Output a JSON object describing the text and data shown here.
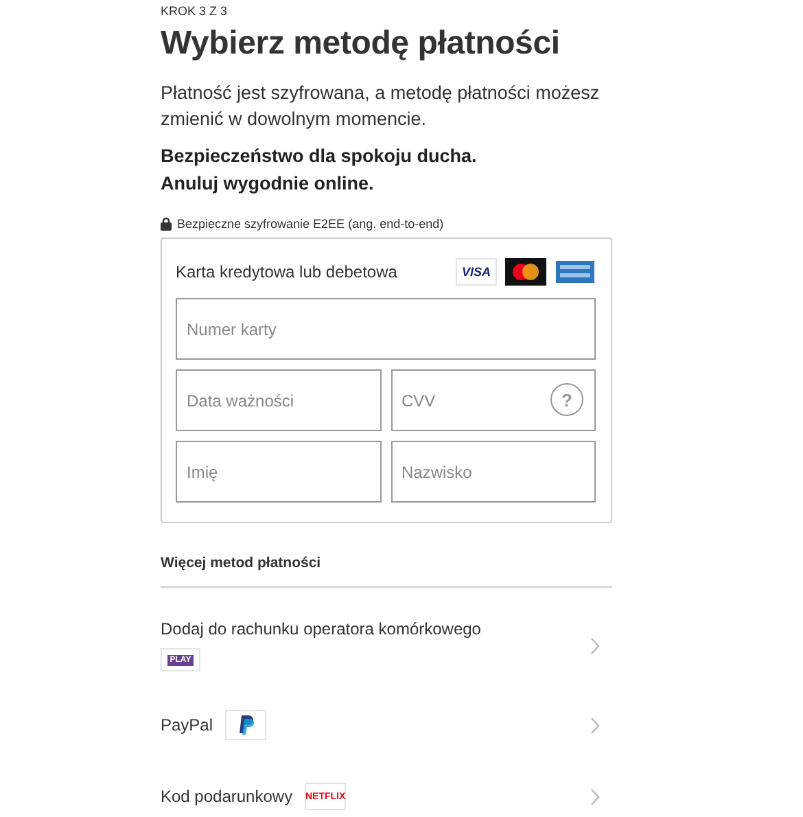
{
  "step": "KROK 3 Z 3",
  "title": "Wybierz metodę płatności",
  "intro": "Płatność jest szyfrowana, a metodę płatności możesz zmienić w dowolnym momencie.",
  "highlights": [
    "Bezpieczeństwo dla spokoju ducha.",
    "Anuluj wygodnie online."
  ],
  "security_note": "Bezpieczne szyfrowanie E2EE (ang. end-to-end)",
  "card": {
    "label": "Karta kredytowa lub debetowa",
    "logos": [
      {
        "kind": "visa",
        "text": "VISA"
      },
      {
        "kind": "mastercard"
      },
      {
        "kind": "amex"
      }
    ],
    "fields": [
      {
        "placeholder": "Numer karty",
        "kind": "wide"
      },
      {
        "placeholder": "Data ważności",
        "kind": "narrow"
      },
      {
        "placeholder": "CVV",
        "kind": "narrow",
        "help": "?"
      },
      {
        "placeholder": "Imię",
        "kind": "narrow"
      },
      {
        "placeholder": "Nazwisko",
        "kind": "narrow"
      }
    ]
  },
  "more_methods": {
    "title": "Więcej metod płatności",
    "items": [
      {
        "label": "Dodaj do rachunku operatora komórkowego",
        "kind": "stacked",
        "logo": {
          "kind": "play",
          "text": "PLAY"
        }
      },
      {
        "label": "PayPal",
        "kind": "inline",
        "logo": {
          "kind": "paypal"
        }
      },
      {
        "label": "Kod podarunkowy",
        "kind": "inline",
        "logo": {
          "kind": "netflix",
          "text": "NETFLIX"
        }
      }
    ]
  }
}
